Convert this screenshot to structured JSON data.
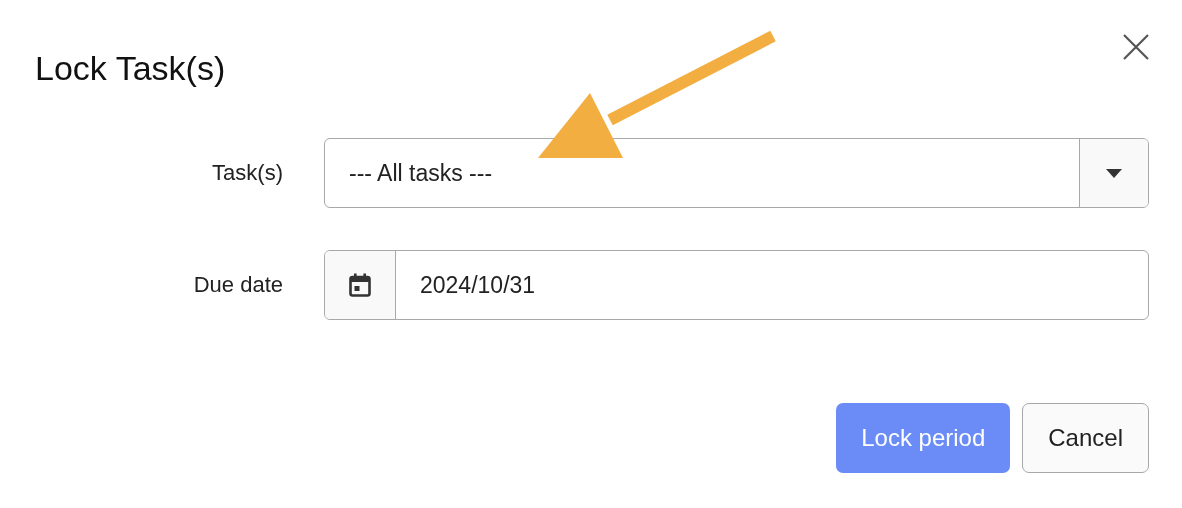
{
  "dialog": {
    "title": "Lock Task(s)"
  },
  "fields": [
    {
      "kind": "select",
      "label": "Task(s)",
      "value": "--- All tasks ---"
    },
    {
      "kind": "date",
      "label": "Due date",
      "value": "2024/10/31"
    }
  ],
  "buttons": [
    {
      "label": "Lock period",
      "kind": "primary"
    },
    {
      "label": "Cancel",
      "kind": "secondary"
    }
  ]
}
